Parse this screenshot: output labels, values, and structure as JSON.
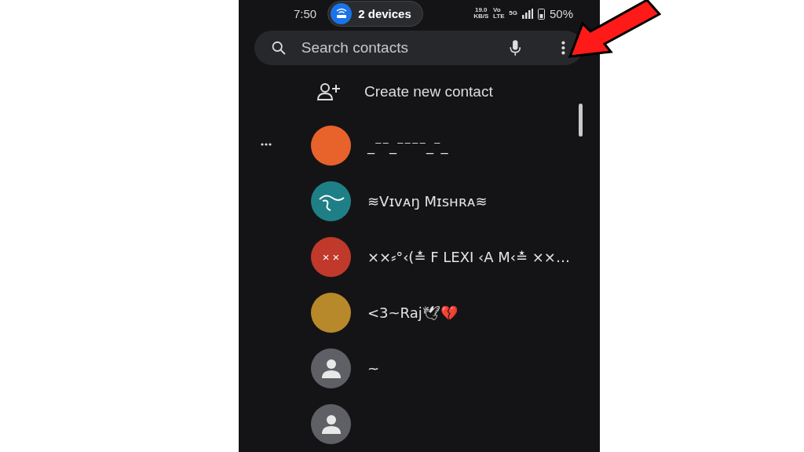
{
  "status_bar": {
    "time": "7:50",
    "hotspot": "2 devices",
    "net_speed": "19.0",
    "net_unit": "KB/S",
    "volte": "Vo LTE",
    "network": "5G",
    "battery": "50%"
  },
  "search": {
    "placeholder": "Search contacts"
  },
  "create_contact": {
    "label": "Create new contact"
  },
  "contacts": [
    {
      "name": "_⁻⁻_⁻⁻⁻⁻_⁻_",
      "kind": "photo",
      "color": "#e8622c"
    },
    {
      "name": "≋Vɪᴠᴀŋ Mɪsʜʀᴀ≋",
      "kind": "logo",
      "color": "#1f7f86"
    },
    {
      "name": "××⸗°‹(≛ F LEXI ‹A M‹≛ ××…",
      "kind": "initials",
      "initials": "× ×",
      "color": "#c0392b"
    },
    {
      "name": "<3~Raj🕊💔",
      "kind": "photo",
      "color": "#b8892a"
    },
    {
      "name": "~",
      "kind": "default",
      "color": "#5f6066"
    },
    {
      "kind": "default",
      "color": "#5f6066"
    }
  ]
}
